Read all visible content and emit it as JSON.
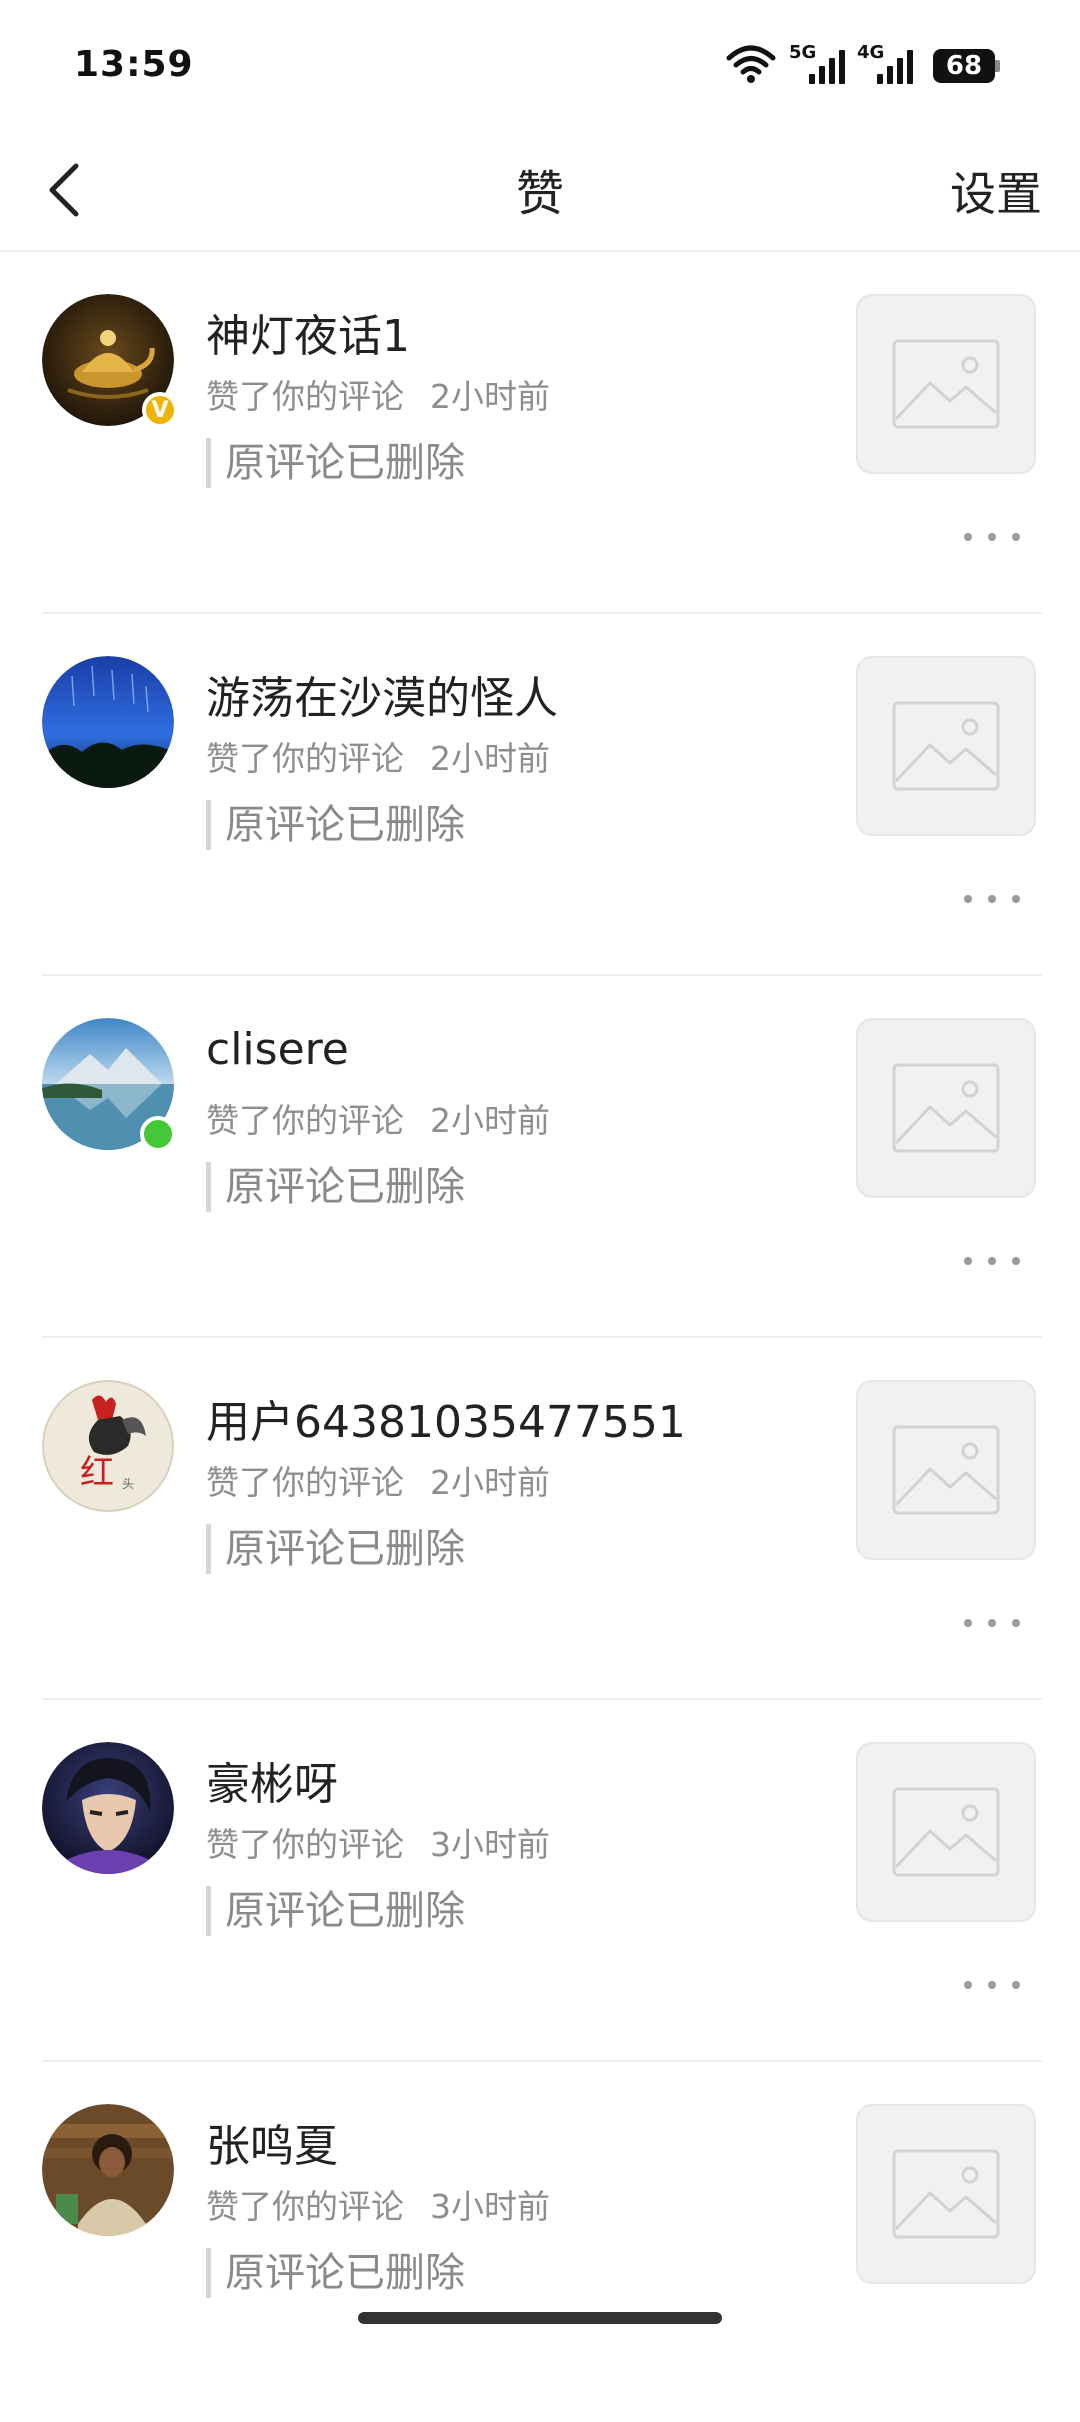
{
  "status_bar": {
    "time": "13:59",
    "net1": "5G",
    "net2": "4G",
    "battery": "68"
  },
  "nav": {
    "title": "赞",
    "settings": "设置"
  },
  "items": [
    {
      "name": "神灯夜话1",
      "action": "赞了你的评论",
      "time": "2小时前",
      "quote": "原评论已删除",
      "avatar": "golden-lamp",
      "badge": "V"
    },
    {
      "name": "游荡在沙漠的怪人",
      "action": "赞了你的评论",
      "time": "2小时前",
      "quote": "原评论已删除",
      "avatar": "starry-night"
    },
    {
      "name": "clisere",
      "action": "赞了你的评论",
      "time": "2小时前",
      "quote": "原评论已删除",
      "avatar": "mountain-lake",
      "online": true
    },
    {
      "name": "用户64381035477551",
      "action": "赞了你的评论",
      "time": "2小时前",
      "quote": "原评论已删除",
      "avatar": "rooster-art"
    },
    {
      "name": "豪彬呀",
      "action": "赞了你的评论",
      "time": "3小时前",
      "quote": "原评论已删除",
      "avatar": "anime-character"
    },
    {
      "name": "张鸣夏",
      "action": "赞了你的评论",
      "time": "3小时前",
      "quote": "原评论已删除",
      "avatar": "child-photo"
    }
  ],
  "colors": {
    "badge_v": "#f0b400",
    "online": "#44c83a",
    "meta_text": "#8e8e8e"
  }
}
